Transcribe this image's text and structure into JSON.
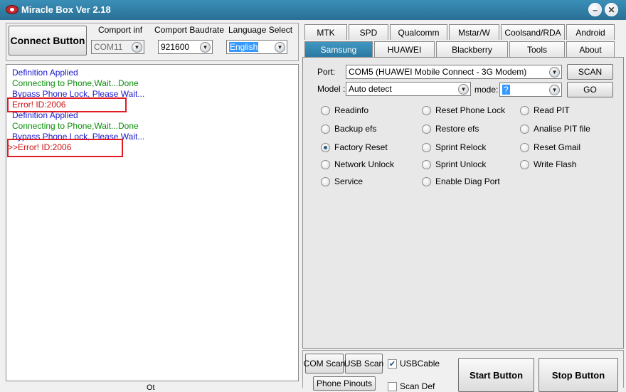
{
  "window": {
    "title": "Miracle Box Ver 2.18",
    "minimize_glyph": "–",
    "close_glyph": "✕",
    "icon": "app-logo-icon"
  },
  "left": {
    "connect_button": "Connect Button",
    "comport_label": "Comport inf",
    "comport_value": "COM11",
    "baudrate_label": "Comport Baudrate",
    "baudrate_value": "921600",
    "language_label": "Language Select",
    "language_value": "English",
    "log": [
      {
        "text": "Definition Applied",
        "color": "#1a1acc"
      },
      {
        "text": "Connecting to Phone,Wait...Done",
        "color": "#0a8f0a"
      },
      {
        "text": "Bypass Phone Lock, Please Wait...",
        "color": "#1a1acc"
      },
      {
        "text": "Error! ID:2006",
        "color": "#cc1111"
      },
      {
        "text": "Definition Applied",
        "color": "#1a1acc"
      },
      {
        "text": "Connecting to Phone,Wait...Done",
        "color": "#0a8f0a"
      },
      {
        "text": "Bypass Phone Lock, Please Wait...",
        "color": "#1a1acc"
      },
      {
        "text": ">>Error! ID:2006",
        "color": "#cc1111"
      }
    ],
    "bottom_partial": "Ot"
  },
  "tabs_row1": [
    "MTK",
    "SPD",
    "Qualcomm",
    "Mstar/W",
    "Coolsand/RDA",
    "Android"
  ],
  "tabs_row2": [
    "Samsung",
    "HUAWEI",
    "Blackberry",
    "Tools",
    "About"
  ],
  "active_tab": "Samsung",
  "samsung": {
    "port_label": "Port:",
    "port_value": "COM5 (HUAWEI Mobile Connect - 3G Modem)",
    "scan_button": "SCAN",
    "model_label": "Model :",
    "model_value": "Auto detect",
    "mode_label": "mode:",
    "mode_value": "?",
    "go_button": "GO",
    "options": [
      "Readinfo",
      "Reset Phone Lock",
      "Read PIT",
      "Backup efs",
      "Restore efs",
      "Analise PIT file",
      "Factory Reset",
      "Sprint Relock",
      "Reset Gmail",
      "Network Unlock",
      "Sprint Unlock",
      "Write Flash",
      "Service",
      "Enable Diag Port"
    ],
    "selected_option": "Factory Reset"
  },
  "bottom": {
    "com_scan": "COM Scan",
    "usb_scan": "USB Scan",
    "usbcable_label": "USBCable",
    "scan_def_label": "Scan Def",
    "phone_pinouts": "Phone Pinouts",
    "start_button": "Start Button",
    "stop_button": "Stop Button"
  },
  "colors": {
    "accent": "#2b79a2",
    "error": "#e01b24"
  }
}
